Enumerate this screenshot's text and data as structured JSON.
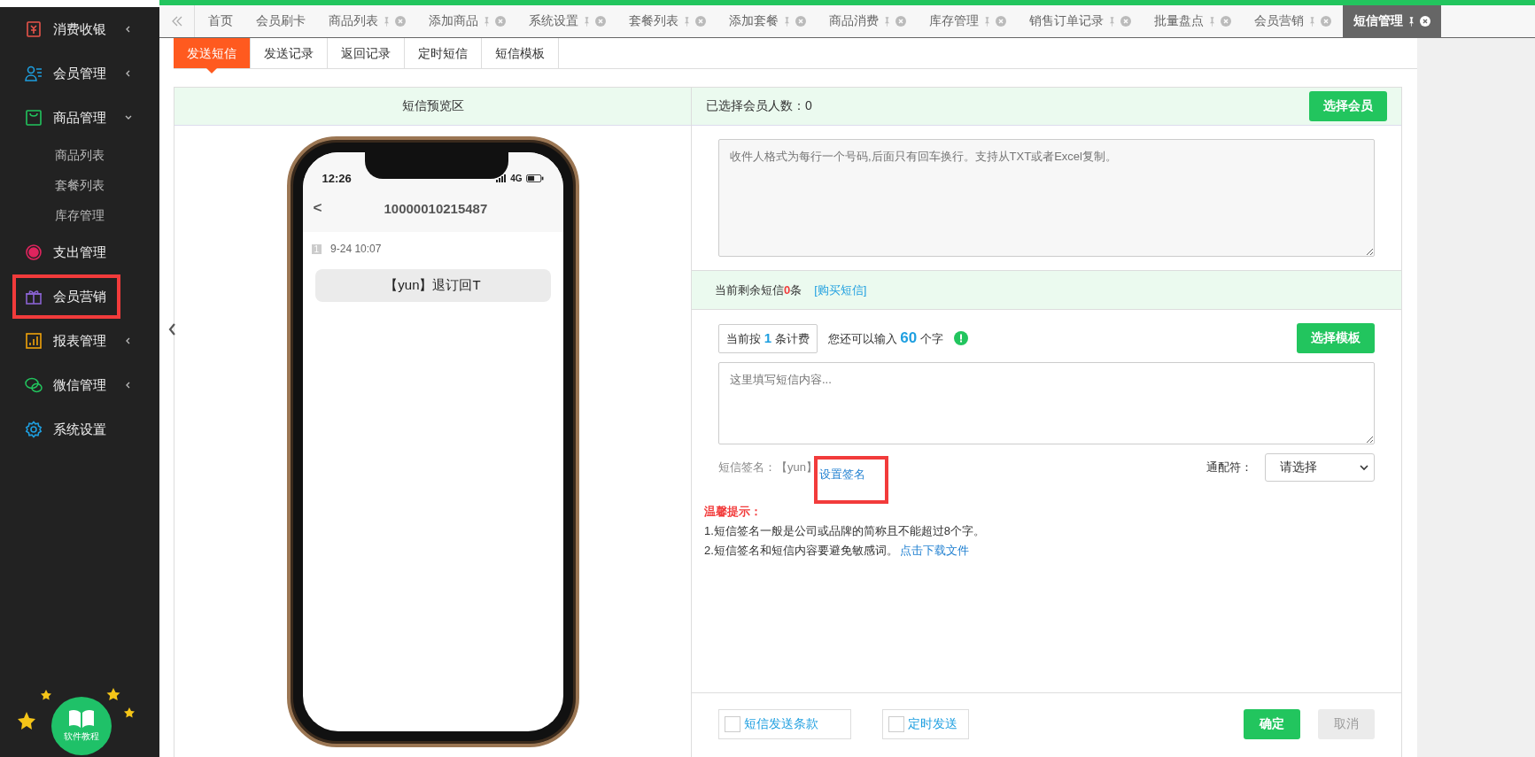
{
  "sidebar": {
    "items": [
      {
        "label": "消费收银",
        "expanded": false,
        "has_arrow": true,
        "highlighted": false
      },
      {
        "label": "会员管理",
        "expanded": false,
        "has_arrow": true,
        "highlighted": false
      },
      {
        "label": "商品管理",
        "expanded": true,
        "has_arrow": true,
        "highlighted": false,
        "children": [
          {
            "label": "商品列表"
          },
          {
            "label": "套餐列表"
          },
          {
            "label": "库存管理"
          }
        ]
      },
      {
        "label": "支出管理",
        "has_arrow": false,
        "highlighted": false
      },
      {
        "label": "会员营销",
        "has_arrow": false,
        "highlighted": true
      },
      {
        "label": "报表管理",
        "expanded": false,
        "has_arrow": true,
        "highlighted": false
      },
      {
        "label": "微信管理",
        "expanded": false,
        "has_arrow": true,
        "highlighted": false
      },
      {
        "label": "系统设置",
        "has_arrow": false,
        "highlighted": false
      }
    ],
    "tutorial": "软件教程"
  },
  "tabs": [
    {
      "label": "首页",
      "closable": false,
      "selected": false
    },
    {
      "label": "会员刷卡",
      "closable": false,
      "selected": false
    },
    {
      "label": "商品列表",
      "closable": true,
      "selected": false
    },
    {
      "label": "添加商品",
      "closable": true,
      "selected": false
    },
    {
      "label": "系统设置",
      "closable": true,
      "selected": false
    },
    {
      "label": "套餐列表",
      "closable": true,
      "selected": false
    },
    {
      "label": "添加套餐",
      "closable": true,
      "selected": false
    },
    {
      "label": "商品消费",
      "closable": true,
      "selected": false
    },
    {
      "label": "库存管理",
      "closable": true,
      "selected": false
    },
    {
      "label": "销售订单记录",
      "closable": true,
      "selected": false
    },
    {
      "label": "批量盘点",
      "closable": true,
      "selected": false
    },
    {
      "label": "会员营销",
      "closable": true,
      "selected": false
    },
    {
      "label": "短信管理",
      "closable": true,
      "selected": true
    }
  ],
  "subtabs": [
    {
      "label": "发送短信",
      "selected": true
    },
    {
      "label": "发送记录",
      "selected": false
    },
    {
      "label": "返回记录",
      "selected": false
    },
    {
      "label": "定时短信",
      "selected": false
    },
    {
      "label": "短信模板",
      "selected": false
    }
  ],
  "preview": {
    "title": "短信预览区",
    "time": "12:26",
    "network": "4G",
    "contact": "10000010215487",
    "back": "<",
    "sim": "1",
    "date": "9-24  10:07",
    "message": "【yun】退订回T"
  },
  "form": {
    "selected_count": "已选择会员人数：0",
    "select_members": "选择会员",
    "recipients": {
      "placeholder": "收件人格式为每行一个号码,后面只有回车换行。支持从TXT或者Excel复制。"
    },
    "balance_prefix": "当前剩余短信",
    "balance_count": "0",
    "balance_suffix": "条",
    "buy_link": "[购买短信]",
    "billing_prefix": "当前按",
    "billing_count": "1",
    "billing_suffix": "条计费",
    "remaining_prefix": "您还可以输入",
    "remaining_count": "60",
    "remaining_suffix": "个字",
    "select_template": "选择模板",
    "content": {
      "placeholder": "这里填写短信内容..."
    },
    "signature_label": "短信签名：【yun】",
    "signature_link": "设置签名",
    "signature_highlighted": true,
    "wildcard_label": "通配符：",
    "wildcard_value": "请选择",
    "tips_title": "温馨提示：",
    "tip_1": "1.短信签名一般是公司或品牌的简称且不能超过8个字。",
    "tip_2": "2.短信签名和短信内容要避免敏感词。",
    "download_link": "点击下载文件",
    "options": [
      {
        "label": "短信发送条款",
        "checked": false
      },
      {
        "label": "定时发送",
        "checked": false
      }
    ],
    "confirm": "确定",
    "cancel": "取消",
    "cancel_disabled": true
  }
}
